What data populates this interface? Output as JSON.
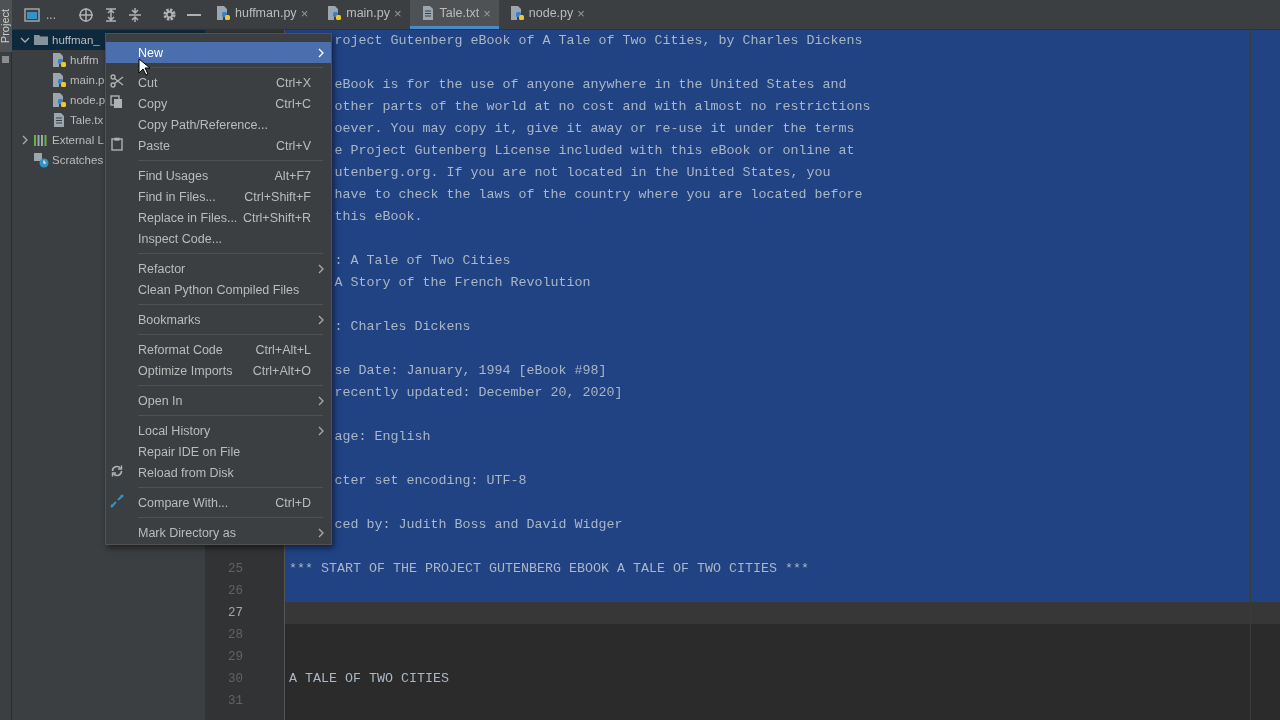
{
  "side_strip": {
    "label": "Project"
  },
  "toolbar": {
    "title": "..."
  },
  "tabs": [
    {
      "label": "huffman.py",
      "kind": "python",
      "selected": false,
      "close": "×"
    },
    {
      "label": "main.py",
      "kind": "python",
      "selected": false,
      "close": "×"
    },
    {
      "label": "Tale.txt",
      "kind": "text",
      "selected": true,
      "close": "×"
    },
    {
      "label": "node.py",
      "kind": "python",
      "selected": false,
      "close": "×"
    }
  ],
  "project_tree": [
    {
      "label": "huffman_",
      "kind": "folder",
      "selected": true,
      "expanded": true,
      "children": [
        {
          "label": "huffm",
          "kind": "python",
          "selected": false
        },
        {
          "label": "main.p",
          "kind": "python",
          "selected": false
        },
        {
          "label": "node.p",
          "kind": "python",
          "selected": false
        },
        {
          "label": "Tale.tx",
          "kind": "text",
          "selected": false
        }
      ]
    },
    {
      "label": "External L",
      "kind": "library",
      "selected": false,
      "expanded": false
    },
    {
      "label": "Scratches",
      "kind": "scratches",
      "selected": false
    }
  ],
  "context_menu": [
    {
      "kind": "item",
      "label": "New",
      "submenu": true,
      "selected": true
    },
    {
      "kind": "separator"
    },
    {
      "kind": "item",
      "label": "Cut",
      "shortcut": "Ctrl+X",
      "submenu": false,
      "selected": false
    },
    {
      "kind": "item",
      "label": "Copy",
      "shortcut": "Ctrl+C",
      "submenu": false,
      "selected": false
    },
    {
      "kind": "item",
      "label": "Copy Path/Reference...",
      "submenu": false,
      "selected": false
    },
    {
      "kind": "item",
      "label": "Paste",
      "shortcut": "Ctrl+V",
      "submenu": false,
      "selected": false
    },
    {
      "kind": "separator"
    },
    {
      "kind": "item",
      "label": "Find Usages",
      "shortcut": "Alt+F7",
      "submenu": false,
      "selected": false
    },
    {
      "kind": "item",
      "label": "Find in Files...",
      "shortcut": "Ctrl+Shift+F",
      "submenu": false,
      "selected": false
    },
    {
      "kind": "item",
      "label": "Replace in Files...",
      "shortcut": "Ctrl+Shift+R",
      "submenu": false,
      "selected": false
    },
    {
      "kind": "item",
      "label": "Inspect Code...",
      "submenu": false,
      "selected": false
    },
    {
      "kind": "separator"
    },
    {
      "kind": "item",
      "label": "Refactor",
      "submenu": true,
      "selected": false
    },
    {
      "kind": "item",
      "label": "Clean Python Compiled Files",
      "submenu": false,
      "selected": false
    },
    {
      "kind": "separator"
    },
    {
      "kind": "item",
      "label": "Bookmarks",
      "submenu": true,
      "selected": false
    },
    {
      "kind": "separator"
    },
    {
      "kind": "item",
      "label": "Reformat Code",
      "shortcut": "Ctrl+Alt+L",
      "submenu": false,
      "selected": false
    },
    {
      "kind": "item",
      "label": "Optimize Imports",
      "shortcut": "Ctrl+Alt+O",
      "submenu": false,
      "selected": false
    },
    {
      "kind": "separator"
    },
    {
      "kind": "item",
      "label": "Open In",
      "submenu": true,
      "selected": false
    },
    {
      "kind": "separator"
    },
    {
      "kind": "item",
      "label": "Local History",
      "submenu": true,
      "selected": false
    },
    {
      "kind": "item",
      "label": "Repair IDE on File",
      "submenu": false,
      "selected": false
    },
    {
      "kind": "item",
      "label": "Reload from Disk",
      "submenu": false,
      "selected": false
    },
    {
      "kind": "separator"
    },
    {
      "kind": "item",
      "label": "Compare With...",
      "shortcut": "Ctrl+D",
      "submenu": false,
      "selected": false
    },
    {
      "kind": "separator"
    },
    {
      "kind": "item",
      "label": "Mark Directory as",
      "submenu": true,
      "selected": false
    }
  ],
  "editor": {
    "lines": [
      {
        "kind": "clipped",
        "text": "roject Gutenberg eBook of A Tale of Two Cities, by Charles Dickens",
        "selected": true,
        "current": false
      },
      {
        "kind": "clipped",
        "selected": true,
        "current": false
      },
      {
        "kind": "clipped",
        "text": "eBook is for the use of anyone anywhere in the United States and",
        "selected": true,
        "current": false
      },
      {
        "kind": "clipped",
        "text": "other parts of the world at no cost and with almost no restrictions",
        "selected": true,
        "current": false
      },
      {
        "kind": "clipped",
        "text": "oever. You may copy it, give it away or re-use it under the terms",
        "selected": true,
        "current": false
      },
      {
        "kind": "clipped",
        "text": "e Project Gutenberg License included with this eBook or online at",
        "selected": true,
        "current": false
      },
      {
        "kind": "clipped",
        "text": "utenberg.org. If you are not located in the United States, you",
        "selected": true,
        "current": false
      },
      {
        "kind": "clipped",
        "text": "have to check the laws of the country where you are located before",
        "selected": true,
        "current": false
      },
      {
        "kind": "clipped",
        "text": "this eBook.",
        "selected": true,
        "current": false
      },
      {
        "kind": "clipped",
        "selected": true,
        "current": false
      },
      {
        "kind": "clipped",
        "text": ": A Tale of Two Cities",
        "selected": true,
        "current": false
      },
      {
        "kind": "clipped",
        "text": "A Story of the French Revolution",
        "selected": true,
        "current": false
      },
      {
        "kind": "clipped",
        "selected": true,
        "current": false
      },
      {
        "kind": "clipped",
        "text": ": Charles Dickens",
        "selected": true,
        "current": false
      },
      {
        "kind": "clipped",
        "selected": true,
        "current": false
      },
      {
        "kind": "clipped",
        "text": "se Date: January, 1994 [eBook #98]",
        "selected": true,
        "current": false
      },
      {
        "kind": "clipped",
        "text": "recently updated: December 20, 2020]",
        "selected": true,
        "current": false
      },
      {
        "kind": "clipped",
        "selected": true,
        "current": false
      },
      {
        "kind": "clipped",
        "text": "age: English",
        "selected": true,
        "current": false
      },
      {
        "kind": "clipped",
        "selected": true,
        "current": false
      },
      {
        "kind": "clipped",
        "text": "cter set encoding: UTF-8",
        "selected": true,
        "current": false
      },
      {
        "kind": "clipped",
        "selected": true,
        "current": false
      },
      {
        "kind": "clipped",
        "text": "ced by: Judith Boss and David Widger",
        "selected": true,
        "current": false
      },
      {
        "kind": "full",
        "selected": true,
        "current": false
      },
      {
        "kind": "full",
        "number": "25",
        "text": "*** START OF THE PROJECT GUTENBERG EBOOK A TALE OF TWO CITIES ***",
        "selected": true,
        "current": false
      },
      {
        "kind": "full",
        "number": "26",
        "selected": true,
        "current": false
      },
      {
        "kind": "full",
        "number": "27",
        "selected": false,
        "current": true
      },
      {
        "kind": "full",
        "number": "28",
        "selected": false,
        "current": false
      },
      {
        "kind": "full",
        "number": "29",
        "selected": false,
        "current": false
      },
      {
        "kind": "full",
        "number": "30",
        "text": "A TALE OF TWO CITIES",
        "selected": false,
        "current": false
      },
      {
        "kind": "full",
        "number": "31",
        "selected": false,
        "current": false
      }
    ]
  }
}
